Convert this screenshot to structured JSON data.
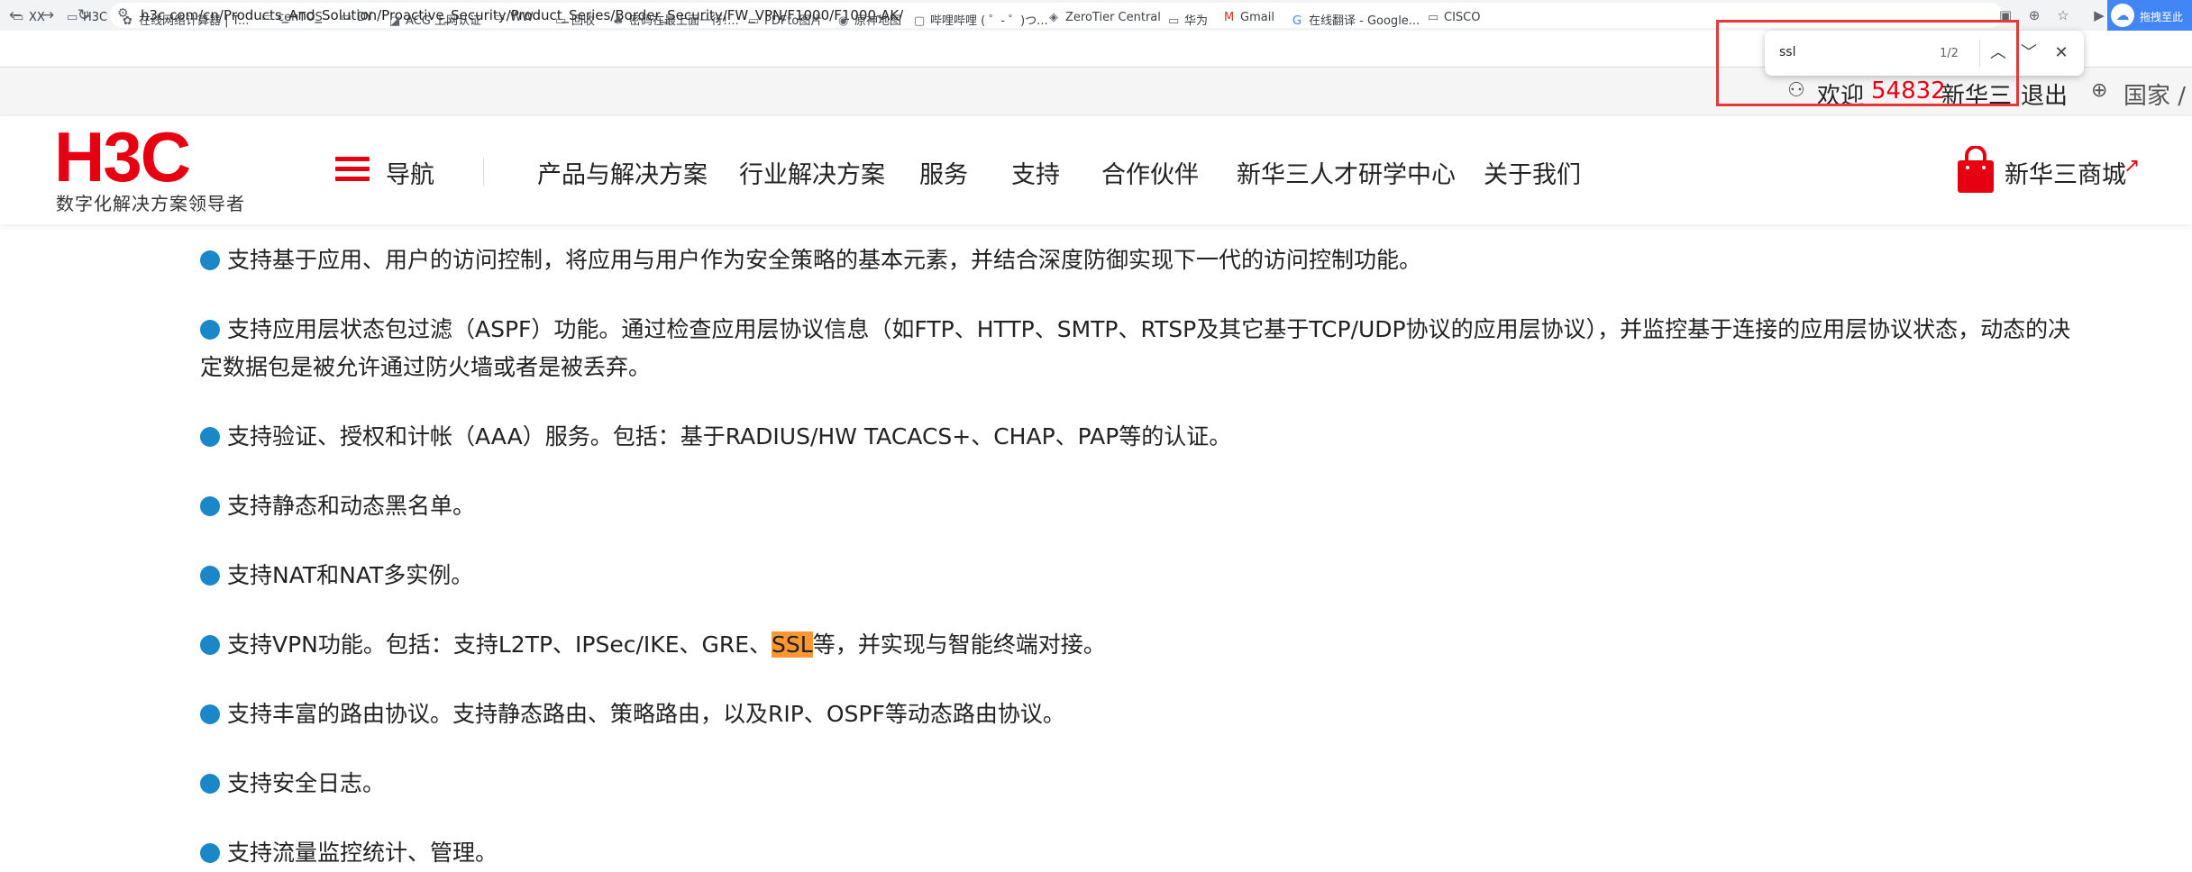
{
  "browser": {
    "url": "h3c.com/cn/Products_And_Solution/Proactive_Security/Product_Series/Border_Security/FW_VPN/F1000/F1000-AK/",
    "extension_label": "拖拽至此"
  },
  "bookmarks": [
    {
      "label": "XX",
      "icon": "folder-icon"
    },
    {
      "label": "H3C",
      "icon": "folder-icon"
    },
    {
      "label": "在线网络计算器 | T...",
      "icon": "gear-icon"
    },
    {
      "label": "cenTOS",
      "icon": "folder-icon"
    },
    {
      "label": "DY",
      "icon": "folder-icon"
    },
    {
      "label": "ACG 上网认证",
      "icon": "site-icon"
    },
    {
      "label": "WW",
      "icon": "folder-icon"
    },
    {
      "label": "回收",
      "icon": "folder-icon"
    },
    {
      "label": "密码在最上面一行!...",
      "icon": "tree-icon"
    },
    {
      "label": "PDFto图片",
      "icon": "folder-icon"
    },
    {
      "label": "原神地图",
      "icon": "site-icon"
    },
    {
      "label": "哔哩哔哩 ( ゜- ゜)つ...",
      "icon": "tv-icon"
    },
    {
      "label": "ZeroTier Central",
      "icon": "site-icon"
    },
    {
      "label": "华为",
      "icon": "folder-icon"
    },
    {
      "label": "Gmail",
      "icon": "gmail-icon"
    },
    {
      "label": "在线翻译 - Google...",
      "icon": "google-icon"
    },
    {
      "label": "CISCO",
      "icon": "folder-icon"
    }
  ],
  "find": {
    "query": "ssl",
    "count": "1/2"
  },
  "util": {
    "welcome": "欢迎",
    "user_number": "54832",
    "user_name": "新华三",
    "logout": "退出",
    "country": "国家 /"
  },
  "header": {
    "logo": "H3C",
    "slogan": "数字化解决方案领导者",
    "nav_label": "导航",
    "menu": [
      "产品与解决方案",
      "行业解决方案",
      "服务",
      "支持",
      "合作伙伴",
      "新华三人才研学中心",
      "关于我们"
    ],
    "mall": "新华三商城"
  },
  "features": [
    "支持基于应用、用户的访问控制，将应用与用户作为安全策略的基本元素，并结合深度防御实现下一代的访问控制功能。",
    "支持应用层状态包过滤（ASPF）功能。通过检查应用层协议信息（如FTP、HTTP、SMTP、RTSP及其它基于TCP/UDP协议的应用层协议），并监控基于连接的应用层协议状态，动态的决定数据包是被允许通过防火墙或者是被丢弃。",
    "支持验证、授权和计帐（AAA）服务。包括：基于RADIUS/HW TACACS+、CHAP、PAP等的认证。",
    "支持静态和动态黑名单。",
    "支持NAT和NAT多实例。",
    {
      "before": "支持VPN功能。包括：支持L2TP、IPSec/IKE、GRE、",
      "highlight": "SSL",
      "after": "等，并实现与智能终端对接。"
    },
    "支持丰富的路由协议。支持静态路由、策略路由，以及RIP、OSPF等动态路由协议。",
    "支持安全日志。",
    "支持流量监控统计、管理。"
  ],
  "colors": {
    "brand_red": "#e60012",
    "bullet_blue": "#1a87c9",
    "find_highlight": "#ff9632",
    "annotation_red": "#e53935"
  }
}
